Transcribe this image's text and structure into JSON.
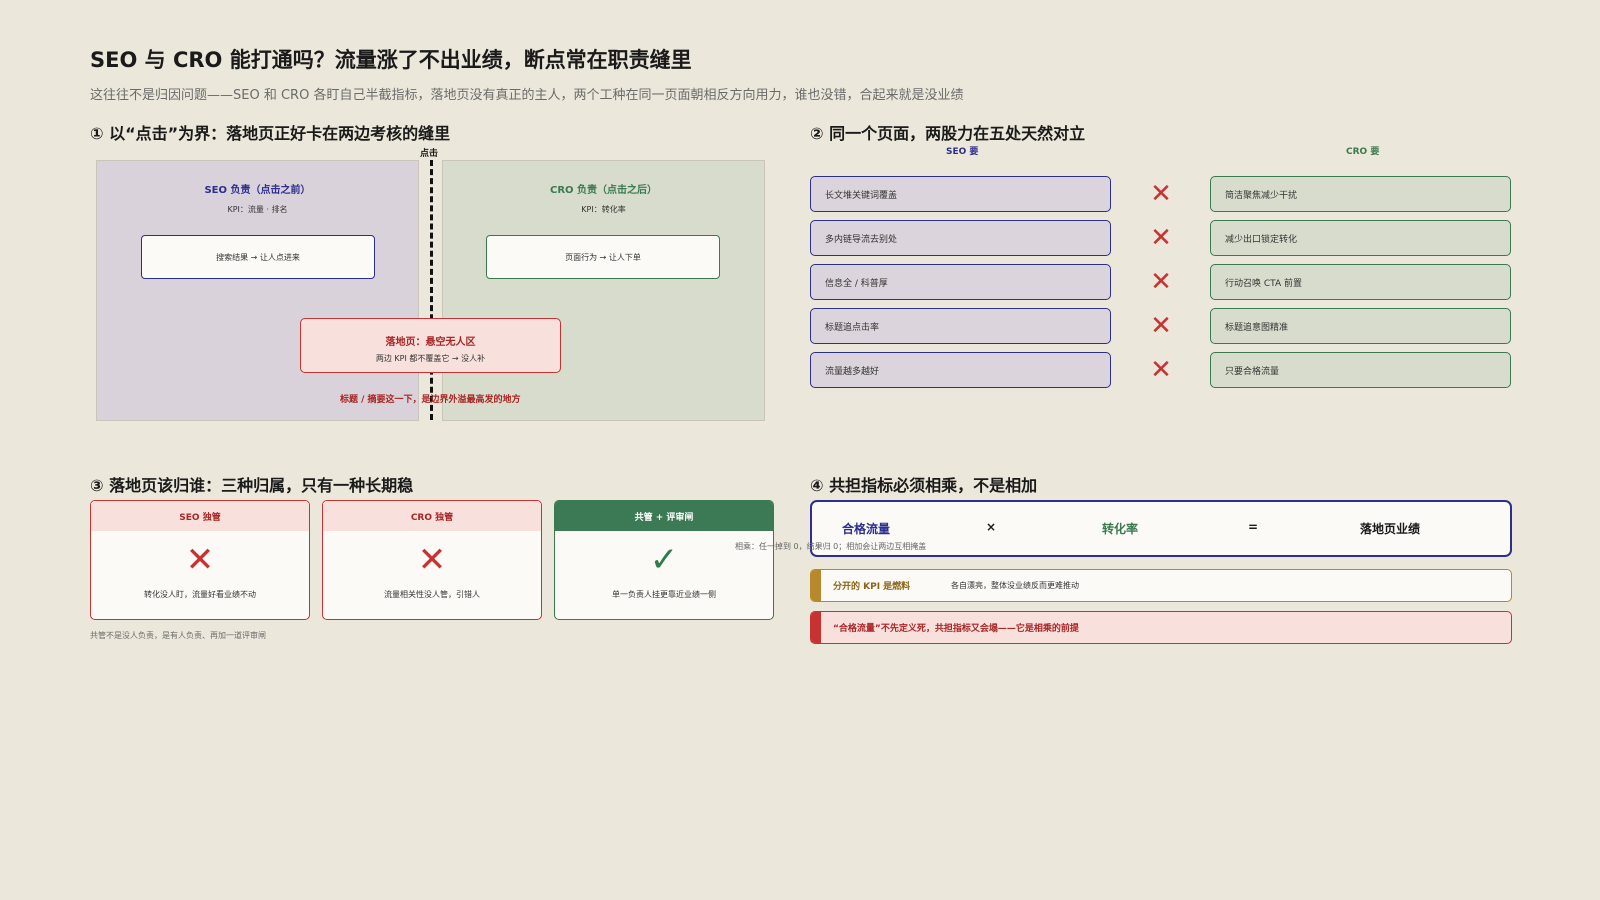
{
  "header": {
    "title": "SEO 与 CRO 能打通吗？流量涨了不出业绩，断点常在职责缝里",
    "subtitle": "这往往不是归因问题——SEO 和 CRO 各盯自己半截指标，落地页没有真正的主人，两个工种在同一页面朝相反方向用力，谁也没错，合起来就是没业绩"
  },
  "section1": {
    "title": "① 以“点击”为界：落地页正好卡在两边考核的缝里",
    "boundary_label": "点击",
    "seo_zone": {
      "title": "SEO 负责（点击之前）",
      "kpi": "KPI：流量 · 排名",
      "box": "搜索结果 → 让人点进来"
    },
    "cro_zone": {
      "title": "CRO 负责（点击之后）",
      "kpi": "KPI：转化率",
      "box": "页面行为 → 让人下单"
    },
    "landing": {
      "title": "落地页：悬空无人区",
      "desc": "两边 KPI 都不覆盖它 → 没人补"
    },
    "note": "标题 / 摘要这一下，是边界外溢最高发的地方"
  },
  "section2": {
    "title": "② 同一个页面，两股力在五处天然对立",
    "seo_head": "SEO 要",
    "cro_head": "CRO 要",
    "rows": [
      {
        "seo": "长文堆关键词覆盖",
        "cro": "简洁聚焦减少干扰"
      },
      {
        "seo": "多内链导流去别处",
        "cro": "减少出口锁定转化"
      },
      {
        "seo": "信息全 / 科普厚",
        "cro": "行动召唤 CTA 前置"
      },
      {
        "seo": "标题追点击率",
        "cro": "标题追意图精准"
      },
      {
        "seo": "流量越多越好",
        "cro": "只要合格流量"
      }
    ],
    "cross_symbol": "✕"
  },
  "section3": {
    "title": "③ 落地页该归谁：三种归属，只有一种长期稳",
    "cards": [
      {
        "head": "SEO 独管",
        "icon": "✕",
        "desc": "转化没人盯，流量好看业绩不动"
      },
      {
        "head": "CRO 独管",
        "icon": "✕",
        "desc": "流量相关性没人管，引错人"
      },
      {
        "head": "共管 + 评审闸",
        "icon": "✓",
        "desc": "单一负责人挂更靠近业绩一侧"
      }
    ],
    "note": "共管不是没人负责，是有人负责、再加一道评审闸"
  },
  "section4": {
    "title": "④ 共担指标必须相乘，不是相加",
    "formula": {
      "a": "合格流量",
      "op1": "×",
      "b": "转化率",
      "op2": "=",
      "c": "落地页业绩"
    },
    "formula_note": "相乘：任一掉到 0，结果归 0；相加会让两边互相掩盖",
    "bars": [
      {
        "label": "分开的 KPI 是燃料",
        "text": "各自漂亮，整体没业绩反而更难推动"
      },
      {
        "label": "“合格流量”不先定义死，共担指标又会塌——它是相乘的前提",
        "text": ""
      }
    ]
  },
  "colors": {
    "seo_blue": "#2d2e8e",
    "cro_green": "#3a7a4e",
    "alert_red": "#c83232",
    "gold": "#b7892c",
    "background": "#ebe7da"
  }
}
